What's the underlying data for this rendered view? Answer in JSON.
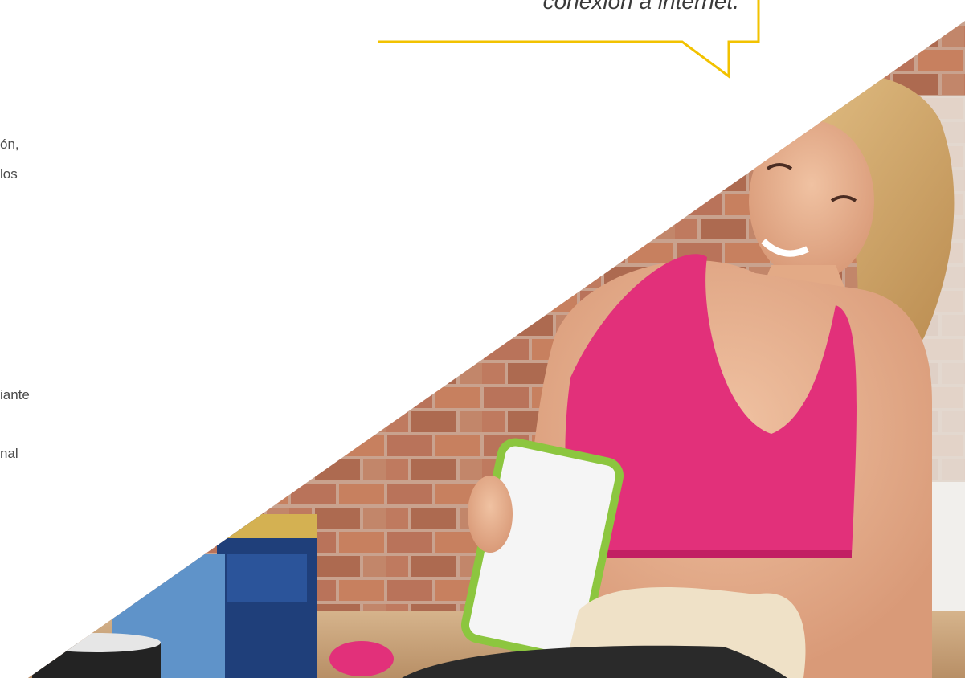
{
  "speech_bubble": {
    "quote": "conexión a internet."
  },
  "left_text": {
    "fragments": [
      "ón,",
      "los",
      "iante",
      "nal"
    ]
  },
  "colors": {
    "bubble_border": "#f2c200",
    "text": "#4a4a4a",
    "top_color": "#e2307a",
    "brick": "#b8765a",
    "container_accent": "#8cc63f"
  },
  "hero_photo": {
    "subject": "woman-in-pink-sports-bra-with-food-container"
  }
}
